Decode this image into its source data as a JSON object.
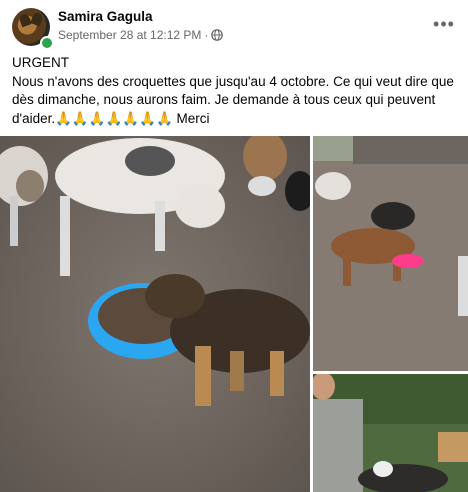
{
  "post": {
    "author": "Samira Gagula",
    "timestamp": "September 28 at 12:12 PM",
    "separator": "·",
    "privacy_icon": "globe-icon",
    "more_icon": "more-options-icon",
    "more_label": "•••",
    "text_line1": "URGENT",
    "text_line2": "Nous n'avons des croquettes que jusqu'au 4 octobre. Ce qui veut dire que dès dimanche, nous aurons faim. Je demande à tous ceux qui peuvent d'aider.",
    "emojis": "🙏🙏🙏🙏🙏🙏🙏",
    "text_end": " Merci"
  },
  "colors": {
    "online": "#31a24c",
    "secondary_text": "#65676b",
    "bowl_blue": "#2aa7f0",
    "bowl_pink": "#ff3c8a"
  }
}
